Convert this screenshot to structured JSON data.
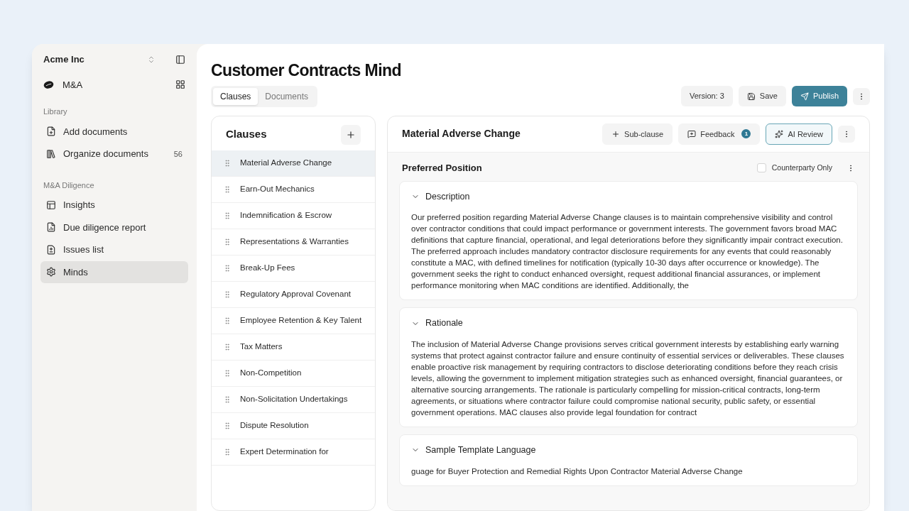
{
  "sidebar": {
    "workspace": "Acme Inc",
    "project": "M&A",
    "sections": [
      {
        "heading": "Library",
        "items": [
          {
            "label": "Add documents",
            "selected": false
          },
          {
            "label": "Organize documents",
            "count": "56",
            "selected": false
          }
        ]
      },
      {
        "heading": "M&A Diligence",
        "items": [
          {
            "label": "Insights",
            "selected": false
          },
          {
            "label": "Due diligence report",
            "selected": false
          },
          {
            "label": "Issues list",
            "selected": false
          },
          {
            "label": "Minds",
            "selected": true
          }
        ]
      }
    ]
  },
  "header": {
    "title": "Customer Contracts Mind",
    "tabs": [
      {
        "label": "Clauses",
        "selected": true
      },
      {
        "label": "Documents",
        "selected": false
      }
    ],
    "version": "Version: 3",
    "actions": [
      {
        "label": "Save",
        "kind": "secondary"
      },
      {
        "label": "Publish",
        "kind": "primary"
      }
    ]
  },
  "clauses_panel": {
    "title": "Clauses",
    "items": [
      {
        "label": "Material Adverse Change",
        "selected": true
      },
      {
        "label": "Earn-Out Mechanics",
        "selected": false
      },
      {
        "label": "Indemnification & Escrow",
        "selected": false
      },
      {
        "label": "Representations & Warranties",
        "selected": false
      },
      {
        "label": "Break-Up Fees",
        "selected": false
      },
      {
        "label": "Regulatory Approval Covenant",
        "selected": false
      },
      {
        "label": "Employee Retention & Key Talent",
        "selected": false
      },
      {
        "label": "Tax Matters",
        "selected": false
      },
      {
        "label": "Non-Competition",
        "selected": false
      },
      {
        "label": "Non-Solicitation Undertakings",
        "selected": false
      },
      {
        "label": "Dispute Resolution",
        "selected": false
      },
      {
        "label": "Expert Determination for",
        "selected": false
      }
    ]
  },
  "clause_detail": {
    "title": "Material Adverse Change",
    "actions": [
      {
        "label": "Sub-clause",
        "kind": "plain"
      },
      {
        "label": "Feedback",
        "kind": "plain",
        "badge": "1"
      },
      {
        "label": "AI Review",
        "kind": "outlined"
      }
    ],
    "position": {
      "title": "Preferred Position",
      "counterparty_only": {
        "label": "Counterparty Only",
        "checked": false
      },
      "sections": [
        {
          "title": "Description",
          "expanded": true,
          "text": "Our preferred position regarding Material Adverse Change clauses is to maintain comprehensive visibility and control over contractor conditions that could impact performance or government interests. The government favors broad MAC definitions that capture financial, operational, and legal deteriorations before they significantly impair contract execution. The preferred approach includes mandatory contractor disclosure requirements for any events that could reasonably constitute a MAC, with defined timelines for notification (typically 10-30 days after occurrence or knowledge). The government seeks the right to conduct enhanced oversight, request additional financial assurances, or implement performance monitoring when MAC conditions are identified. Additionally, the"
        },
        {
          "title": "Rationale",
          "expanded": true,
          "text": "The inclusion of Material Adverse Change provisions serves critical government interests by establishing early warning systems that protect against contractor failure and ensure continuity of essential services or deliverables. These clauses enable proactive risk management by requiring contractors to disclose deteriorating conditions before they reach crisis levels, allowing the government to implement mitigation strategies such as enhanced oversight, financial guarantees, or alternative sourcing arrangements. The rationale is particularly compelling for mission-critical contracts, long-term agreements, or situations where contractor failure could compromise national security, public safety, or essential government operations. MAC clauses also provide legal foundation for contract"
        },
        {
          "title": "Sample Template Language",
          "expanded": true,
          "text": "guage for Buyer Protection and Remedial Rights Upon Contractor Material Adverse Change"
        }
      ]
    }
  }
}
